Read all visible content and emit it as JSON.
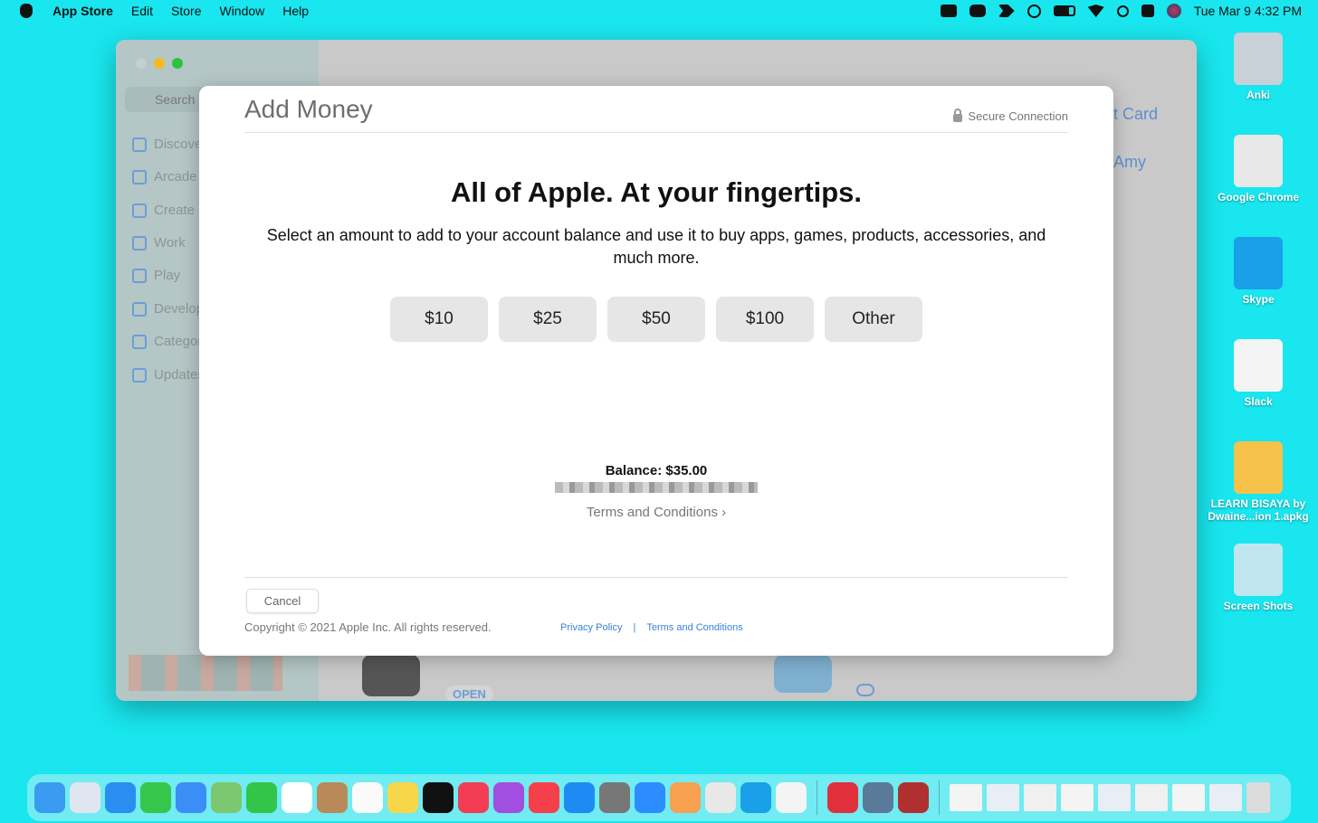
{
  "menubar": {
    "app": "App Store",
    "items": [
      "Edit",
      "Store",
      "Window",
      "Help"
    ],
    "clock": "Tue Mar 9  4:32 PM",
    "status_icons": [
      "zoom-icon",
      "tasks-icon",
      "reeder-icon",
      "play-icon",
      "battery-icon",
      "wifi-icon",
      "search-icon",
      "control-center-icon",
      "siri-icon"
    ]
  },
  "window": {
    "search_placeholder": "Search",
    "sidebar": [
      "Discover",
      "Arcade",
      "Create",
      "Work",
      "Play",
      "Develop",
      "Categories",
      "Updates"
    ],
    "right_text": [
      "t Card",
      "Amy"
    ],
    "open_label": "OPEN"
  },
  "modal": {
    "title": "Add Money",
    "secure": "Secure Connection",
    "headline": "All of Apple. At your fingertips.",
    "description": "Select an amount to add to your account balance and use it to buy apps, games, products, accessories, and much more.",
    "amounts": [
      "$10",
      "$25",
      "$50",
      "$100",
      "Other"
    ],
    "balance": "Balance: $35.00",
    "terms": "Terms and Conditions ›",
    "cancel": "Cancel",
    "copyright": "Copyright © 2021 Apple Inc. All rights reserved.",
    "privacy": "Privacy Policy",
    "separator": "|",
    "footer_terms": "Terms and Conditions"
  },
  "desktop": [
    {
      "label": "Anki",
      "color": "#c8d0d8"
    },
    {
      "label": "Google Chrome",
      "color": "#e8e8e8"
    },
    {
      "label": "Skype",
      "color": "#1aa0e8"
    },
    {
      "label": "Slack",
      "color": "#f4f4f4"
    },
    {
      "label": "LEARN BISAYA by Dwaine...ion 1.apkg",
      "color": "#f6c24a"
    },
    {
      "label": "Screen Shots",
      "color": "#bfe6ef"
    }
  ],
  "dock": {
    "apps": [
      {
        "name": "finder",
        "color": "#3a9cf0"
      },
      {
        "name": "launchpad",
        "color": "#e0e6f0"
      },
      {
        "name": "safari",
        "color": "#2a8ef0"
      },
      {
        "name": "messages",
        "color": "#37c54c"
      },
      {
        "name": "mail",
        "color": "#3a8ef6"
      },
      {
        "name": "maps",
        "color": "#7cc870"
      },
      {
        "name": "facetime",
        "color": "#33c44a"
      },
      {
        "name": "calendar",
        "color": "#ffffff"
      },
      {
        "name": "contacts",
        "color": "#b88a5a"
      },
      {
        "name": "reminders",
        "color": "#fafafa"
      },
      {
        "name": "notes",
        "color": "#f8d64a"
      },
      {
        "name": "tv",
        "color": "#111111"
      },
      {
        "name": "music",
        "color": "#f23d55"
      },
      {
        "name": "podcasts",
        "color": "#a24ee0"
      },
      {
        "name": "news",
        "color": "#f5404c"
      },
      {
        "name": "app-store",
        "color": "#1c8cf4"
      },
      {
        "name": "system-preferences",
        "color": "#777777"
      },
      {
        "name": "zoom",
        "color": "#2d8cff"
      },
      {
        "name": "photos",
        "color": "#f6a050"
      },
      {
        "name": "chrome",
        "color": "#e8e8e8"
      },
      {
        "name": "skype",
        "color": "#1aa0e8"
      },
      {
        "name": "slack",
        "color": "#f4f4f4"
      },
      {
        "name": "reeder",
        "color": "#e0303c"
      },
      {
        "name": "preview",
        "color": "#5a7a9a"
      },
      {
        "name": "dictionary",
        "color": "#b03030"
      }
    ],
    "docs": [
      "#f4f4f4",
      "#e8eef4",
      "#f0f0f0",
      "#f4f4f4",
      "#e8eef4",
      "#f0f0f0",
      "#f4f4f4",
      "#e8eef4"
    ],
    "trash": "#dcdcdc"
  }
}
